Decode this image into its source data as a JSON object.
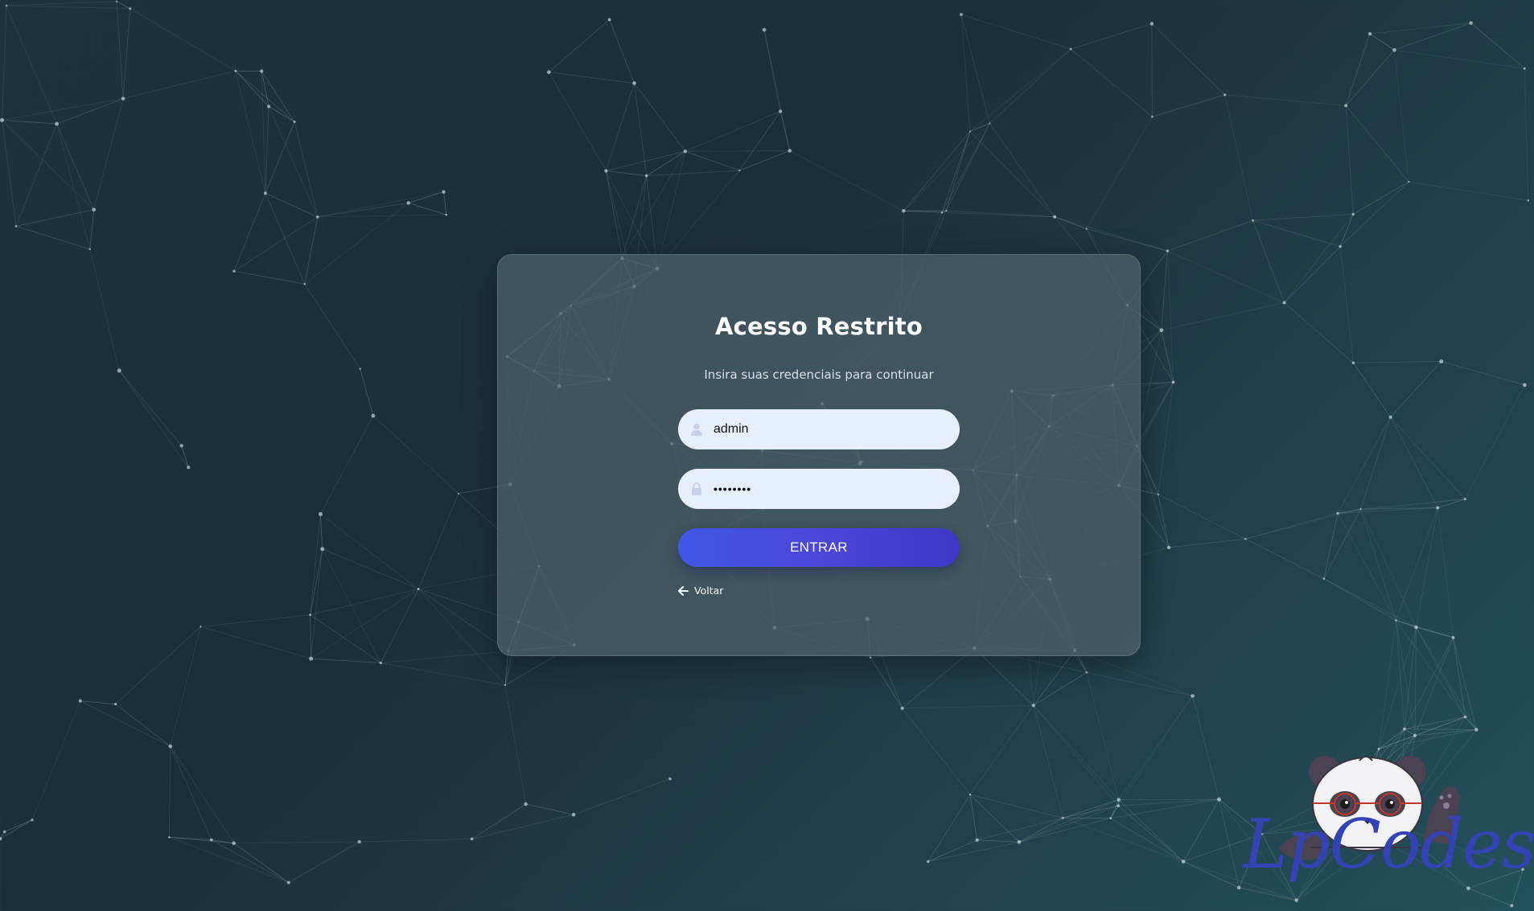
{
  "login": {
    "title": "Acesso Restrito",
    "subtitle": "Insira suas credenciais para continuar",
    "username": {
      "value": "admin",
      "icon": "user-icon"
    },
    "password": {
      "value": "••••••••",
      "icon": "lock-icon"
    },
    "submit_label": "ENTRAR",
    "back_label": "Voltar",
    "back_icon": "arrow-left-icon"
  },
  "branding": {
    "logo_text": "LpCodes",
    "mascot": "panda-mascot"
  },
  "colors": {
    "button_start": "#4157e6",
    "button_end": "#3f36c6",
    "field_bg": "#e8effc",
    "logo_text": "#3443b4"
  }
}
